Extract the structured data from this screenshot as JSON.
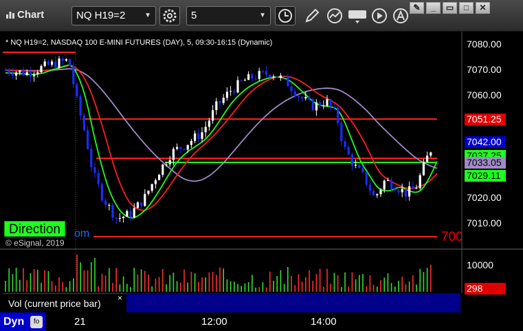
{
  "toolbar": {
    "app_title": "Chart",
    "symbol": "NQ H19=2",
    "interval": "5"
  },
  "chart": {
    "status_line": "* NQ H19=2, NASDAQ 100 E-MINI FUTURES (DAY), 5, 09:30-16:15 (Dynamic)",
    "copyright": "© eSignal, 2019",
    "direction_label": "Direction",
    "direction_tail": "om",
    "cut_label": "700",
    "price_ticks": [
      "7080.00",
      "7070.00",
      "7060.00",
      "7051.25",
      "7042.00",
      "7037.25",
      "7033.05",
      "7029.11",
      "7020.00",
      "7010.00"
    ],
    "tags": [
      {
        "text": "7051.25",
        "bg": "#e00000",
        "fg": "#ffffff"
      },
      {
        "text": "7042.00",
        "bg": "#0000cc",
        "fg": "#ffffff"
      },
      {
        "text": "7037.25",
        "bg": "#1eff1e",
        "fg": "#000000"
      },
      {
        "text": "7033.05",
        "bg": "#a08bc8",
        "fg": "#000000"
      },
      {
        "text": "7029.11",
        "bg": "#1eff1e",
        "fg": "#000000"
      }
    ]
  },
  "volume": {
    "label": "Vol (current price bar)",
    "close_glyph": "×",
    "tick": "10000",
    "current": "298"
  },
  "bottom": {
    "dyn_label": "Dyn",
    "time_labels": [
      "21",
      "12:00",
      "14:00"
    ]
  },
  "colors": {
    "up": "#ffffff",
    "down": "#1a2cff",
    "ma_fast": "#1eff1e",
    "ma_red": "#ff1e1e",
    "ma_purple": "#a08bc8",
    "level_red": "#ff1e1e",
    "level_green": "#1eff1e"
  }
}
